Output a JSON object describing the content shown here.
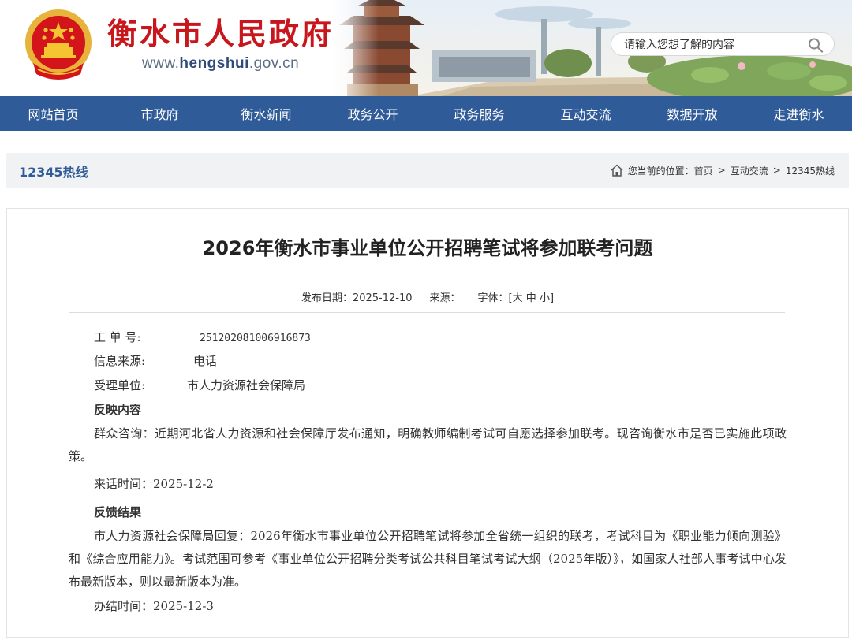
{
  "header": {
    "site_title": "衡水市人民政府",
    "site_url_prefix": "www.",
    "site_url_bold": "hengshui",
    "site_url_suffix": ".gov.cn",
    "search_placeholder": "请输入您想了解的内容",
    "brand_color": "#c8161d"
  },
  "nav": {
    "items": [
      "网站首页",
      "市政府",
      "衡水新闻",
      "政务公开",
      "政务服务",
      "互动交流",
      "数据开放",
      "走进衡水"
    ],
    "color": "#2f5b98"
  },
  "location": {
    "section_title": "12345热线",
    "prefix": "您当前的位置：",
    "crumbs": [
      "首页",
      "互动交流",
      "12345热线"
    ],
    "separator": ">"
  },
  "article": {
    "title": "2026年衡水市事业单位公开招聘笔试将参加联考问题",
    "meta": {
      "date_label": "发布日期：2025-12-10",
      "source_label": "来源：",
      "font_label": "字体：[",
      "font_large": "大",
      "font_medium": "中",
      "font_small": "小",
      "font_close": "]"
    },
    "fields": {
      "ticket_label": "工 单 号:",
      "ticket_value": "251202081006916873",
      "source_label": "信息来源:",
      "source_value": "电话",
      "unit_label": "受理单位:",
      "unit_value": "市人力资源社会保障局"
    },
    "reflect_heading": "反映内容",
    "reflect_text": "群众咨询：近期河北省人力资源和社会保障厅发布通知，明确教师编制考试可自愿选择参加联考。现咨询衡水市是否已实施此项政策。",
    "call_time": "来话时间：2025-12-2",
    "feedback_heading": "反馈结果",
    "feedback_text": "市人力资源社会保障局回复：2026年衡水市事业单位公开招聘笔试将参加全省统一组织的联考，考试科目为《职业能力倾向测验》和《综合应用能力》。考试范围可参考《事业单位公开招聘分类考试公共科目笔试考试大纲（2025年版）》，如国家人社部人事考试中心发布最新版本，则以最新版本为准。",
    "done_time": "办结时间：2025-12-3"
  }
}
